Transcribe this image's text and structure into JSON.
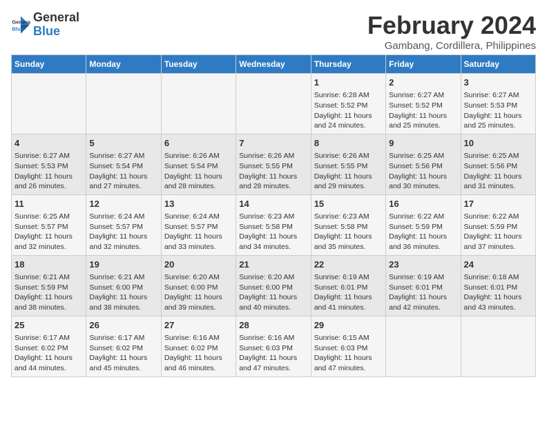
{
  "header": {
    "logo_line1": "General",
    "logo_line2": "Blue",
    "title": "February 2024",
    "subtitle": "Gambang, Cordillera, Philippines"
  },
  "weekdays": [
    "Sunday",
    "Monday",
    "Tuesday",
    "Wednesday",
    "Thursday",
    "Friday",
    "Saturday"
  ],
  "weeks": [
    [
      {
        "day": "",
        "info": ""
      },
      {
        "day": "",
        "info": ""
      },
      {
        "day": "",
        "info": ""
      },
      {
        "day": "",
        "info": ""
      },
      {
        "day": "1",
        "info": "Sunrise: 6:28 AM\nSunset: 5:52 PM\nDaylight: 11 hours and 24 minutes."
      },
      {
        "day": "2",
        "info": "Sunrise: 6:27 AM\nSunset: 5:52 PM\nDaylight: 11 hours and 25 minutes."
      },
      {
        "day": "3",
        "info": "Sunrise: 6:27 AM\nSunset: 5:53 PM\nDaylight: 11 hours and 25 minutes."
      }
    ],
    [
      {
        "day": "4",
        "info": "Sunrise: 6:27 AM\nSunset: 5:53 PM\nDaylight: 11 hours and 26 minutes."
      },
      {
        "day": "5",
        "info": "Sunrise: 6:27 AM\nSunset: 5:54 PM\nDaylight: 11 hours and 27 minutes."
      },
      {
        "day": "6",
        "info": "Sunrise: 6:26 AM\nSunset: 5:54 PM\nDaylight: 11 hours and 28 minutes."
      },
      {
        "day": "7",
        "info": "Sunrise: 6:26 AM\nSunset: 5:55 PM\nDaylight: 11 hours and 28 minutes."
      },
      {
        "day": "8",
        "info": "Sunrise: 6:26 AM\nSunset: 5:55 PM\nDaylight: 11 hours and 29 minutes."
      },
      {
        "day": "9",
        "info": "Sunrise: 6:25 AM\nSunset: 5:56 PM\nDaylight: 11 hours and 30 minutes."
      },
      {
        "day": "10",
        "info": "Sunrise: 6:25 AM\nSunset: 5:56 PM\nDaylight: 11 hours and 31 minutes."
      }
    ],
    [
      {
        "day": "11",
        "info": "Sunrise: 6:25 AM\nSunset: 5:57 PM\nDaylight: 11 hours and 32 minutes."
      },
      {
        "day": "12",
        "info": "Sunrise: 6:24 AM\nSunset: 5:57 PM\nDaylight: 11 hours and 32 minutes."
      },
      {
        "day": "13",
        "info": "Sunrise: 6:24 AM\nSunset: 5:57 PM\nDaylight: 11 hours and 33 minutes."
      },
      {
        "day": "14",
        "info": "Sunrise: 6:23 AM\nSunset: 5:58 PM\nDaylight: 11 hours and 34 minutes."
      },
      {
        "day": "15",
        "info": "Sunrise: 6:23 AM\nSunset: 5:58 PM\nDaylight: 11 hours and 35 minutes."
      },
      {
        "day": "16",
        "info": "Sunrise: 6:22 AM\nSunset: 5:59 PM\nDaylight: 11 hours and 36 minutes."
      },
      {
        "day": "17",
        "info": "Sunrise: 6:22 AM\nSunset: 5:59 PM\nDaylight: 11 hours and 37 minutes."
      }
    ],
    [
      {
        "day": "18",
        "info": "Sunrise: 6:21 AM\nSunset: 5:59 PM\nDaylight: 11 hours and 38 minutes."
      },
      {
        "day": "19",
        "info": "Sunrise: 6:21 AM\nSunset: 6:00 PM\nDaylight: 11 hours and 38 minutes."
      },
      {
        "day": "20",
        "info": "Sunrise: 6:20 AM\nSunset: 6:00 PM\nDaylight: 11 hours and 39 minutes."
      },
      {
        "day": "21",
        "info": "Sunrise: 6:20 AM\nSunset: 6:00 PM\nDaylight: 11 hours and 40 minutes."
      },
      {
        "day": "22",
        "info": "Sunrise: 6:19 AM\nSunset: 6:01 PM\nDaylight: 11 hours and 41 minutes."
      },
      {
        "day": "23",
        "info": "Sunrise: 6:19 AM\nSunset: 6:01 PM\nDaylight: 11 hours and 42 minutes."
      },
      {
        "day": "24",
        "info": "Sunrise: 6:18 AM\nSunset: 6:01 PM\nDaylight: 11 hours and 43 minutes."
      }
    ],
    [
      {
        "day": "25",
        "info": "Sunrise: 6:17 AM\nSunset: 6:02 PM\nDaylight: 11 hours and 44 minutes."
      },
      {
        "day": "26",
        "info": "Sunrise: 6:17 AM\nSunset: 6:02 PM\nDaylight: 11 hours and 45 minutes."
      },
      {
        "day": "27",
        "info": "Sunrise: 6:16 AM\nSunset: 6:02 PM\nDaylight: 11 hours and 46 minutes."
      },
      {
        "day": "28",
        "info": "Sunrise: 6:16 AM\nSunset: 6:03 PM\nDaylight: 11 hours and 47 minutes."
      },
      {
        "day": "29",
        "info": "Sunrise: 6:15 AM\nSunset: 6:03 PM\nDaylight: 11 hours and 47 minutes."
      },
      {
        "day": "",
        "info": ""
      },
      {
        "day": "",
        "info": ""
      }
    ]
  ]
}
